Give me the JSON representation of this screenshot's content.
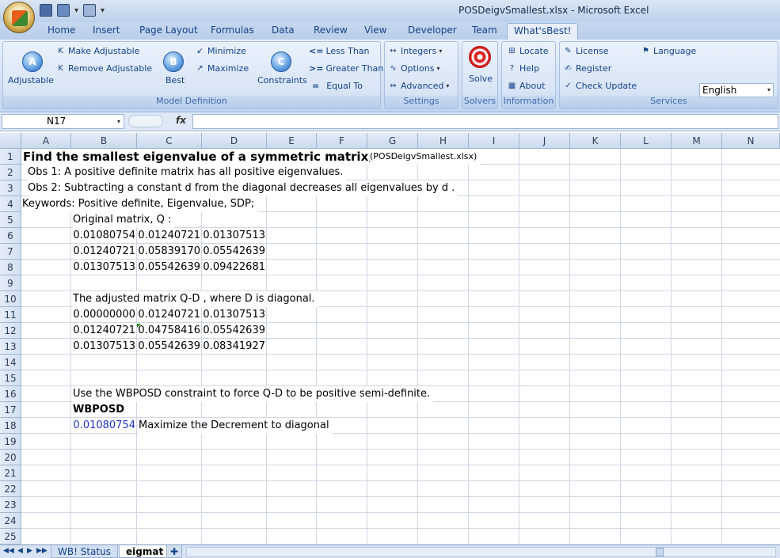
{
  "window": {
    "title": "POSDeigvSmallest.xlsx - Microsoft Excel"
  },
  "tabs": [
    "Home",
    "Insert",
    "Page Layout",
    "Formulas",
    "Data",
    "Review",
    "View",
    "Developer",
    "Team",
    "What'sBest!"
  ],
  "ribbon": {
    "model_definition": {
      "label": "Model Definition",
      "adjustable": "Adjustable",
      "make_adjustable": "Make Adjustable",
      "remove_adjustable": "Remove Adjustable",
      "best": "Best",
      "minimize": "Minimize",
      "maximize": "Maximize",
      "constraints": "Constraints",
      "less_than": "Less Than",
      "greater_than": "Greater Than",
      "equal_to": "Equal To"
    },
    "settings": {
      "label": "Settings",
      "integers": "Integers",
      "options": "Options",
      "advanced": "Advanced"
    },
    "solvers": {
      "label": "Solvers",
      "solve": "Solve"
    },
    "information": {
      "label": "Information",
      "locate": "Locate",
      "help": "Help",
      "about": "About"
    },
    "services": {
      "label": "Services",
      "license": "License",
      "register": "Register",
      "check_update": "Check Update",
      "language": "Language",
      "language_value": "English"
    },
    "icons": {
      "less": "<=",
      "greater": ">=",
      "equal": "="
    }
  },
  "formula_bar": {
    "name_box": "N17",
    "fx": "fx",
    "formula": ""
  },
  "columns": [
    "A",
    "B",
    "C",
    "D",
    "E",
    "F",
    "G",
    "H",
    "I",
    "J",
    "K",
    "L",
    "M",
    "N"
  ],
  "rows": [
    "1",
    "2",
    "3",
    "4",
    "5",
    "6",
    "7",
    "8",
    "9",
    "10",
    "11",
    "12",
    "13",
    "14",
    "15",
    "16",
    "17",
    "18",
    "19",
    "20",
    "21",
    "22",
    "23",
    "24",
    "25"
  ],
  "cells": {
    "title": "Find the smallest eigenvalue of a symmetric matrix;",
    "filename": "(POSDeigvSmallest.xlsx)",
    "obs1": "Obs 1: A positive definite matrix has all positive eigenvalues.",
    "obs2": "Obs 2: Subtracting a constant d  from the diagonal decreases all eigenvalues by d .",
    "keywords": "Keywords: Positive definite, Eigenvalue, SDP;",
    "orig_label": "Original matrix, Q :",
    "Q": [
      [
        "0.01080754",
        "0.01240721",
        "0.01307513"
      ],
      [
        "0.01240721",
        "0.05839170",
        "0.05542639"
      ],
      [
        "0.01307513",
        "0.05542639",
        "0.09422681"
      ]
    ],
    "adj_label": "The adjusted matrix  Q-D , where D  is diagonal.",
    "QD": [
      [
        "0.00000000",
        "0.01240721",
        "0.01307513"
      ],
      [
        "0.01240721",
        "0.04758416",
        "0.05542639"
      ],
      [
        "0.01307513",
        "0.05542639",
        "0.08341927"
      ]
    ],
    "use_text": "Use the WBPOSD constraint to force Q-D  to be positive semi-definite.",
    "wbposd": "WBPOSD",
    "decrement": "0.01080754",
    "maximize_text": "Maximize the Decrement to diagonal"
  },
  "sheet_tabs": [
    "WB! Status",
    "eigmat"
  ]
}
